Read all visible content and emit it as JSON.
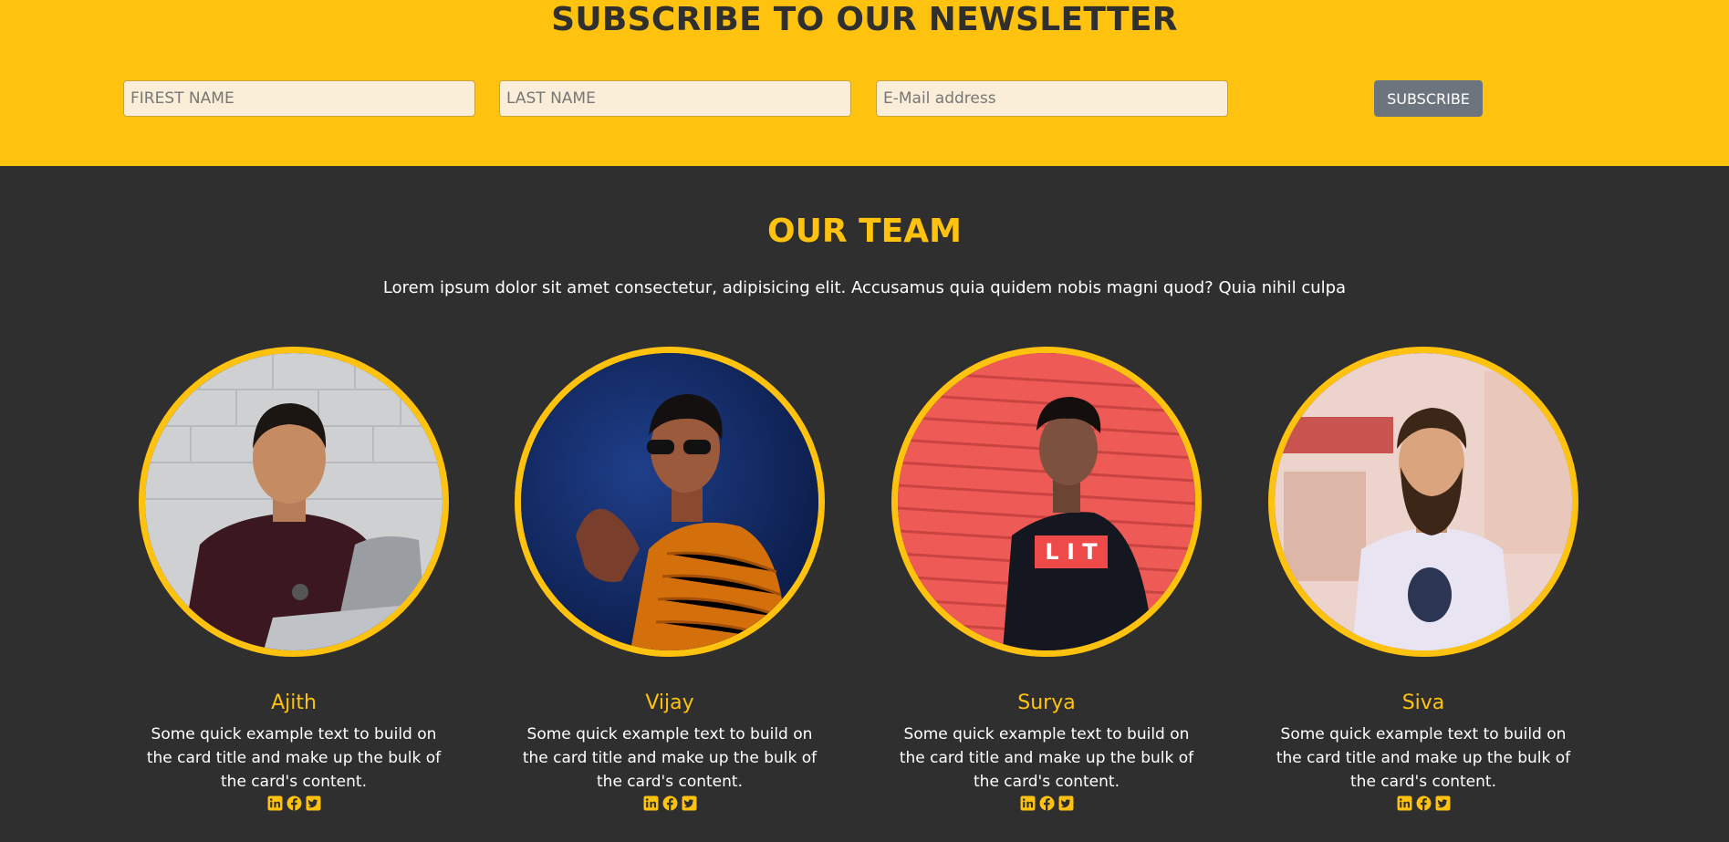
{
  "newsletter": {
    "title": "SUBSCRIBE TO OUR NEWSLETTER",
    "first_name_placeholder": "FIREST NAME",
    "last_name_placeholder": "LAST NAME",
    "email_placeholder": "E-Mail address",
    "subscribe_label": "SUBSCRIBE"
  },
  "team": {
    "title": "OUR TEAM",
    "subtitle": "Lorem ipsum dolor sit amet consectetur, adipisicing elit. Accusamus quia quidem nobis magni quod? Quia nihil culpa",
    "members": [
      {
        "name": "Ajith",
        "text": "Some quick example text to build on the card title and make up the bulk of the card's content."
      },
      {
        "name": "Vijay",
        "text": "Some quick example text to build on the card title and make up the bulk of the card's content."
      },
      {
        "name": "Surya",
        "text": "Some quick example text to build on the card title and make up the bulk of the card's content."
      },
      {
        "name": "Siva",
        "text": "Some quick example text to build on the card title and make up the bulk of the card's content."
      }
    ],
    "social_icons": [
      "linkedin-icon",
      "facebook-icon",
      "twitter-icon"
    ]
  },
  "colors": {
    "accent": "#ffc20e",
    "dark_background": "#2f2f2f",
    "input_background": "#faeed8",
    "button_gray": "#6c757d",
    "text_light": "#ffffff"
  }
}
